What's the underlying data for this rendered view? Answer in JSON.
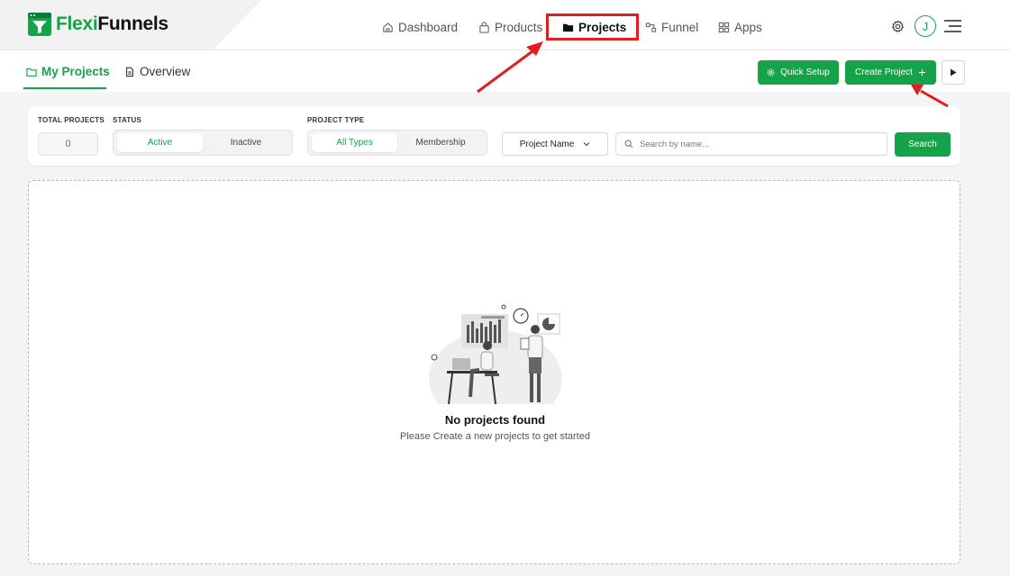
{
  "brand": {
    "name_part1": "Flexi",
    "name_part2": "Funnels",
    "logo_icon": "funnel-logo-icon",
    "accent": "#15a34a"
  },
  "nav": {
    "items": [
      {
        "label": "Dashboard",
        "icon": "home-icon"
      },
      {
        "label": "Products",
        "icon": "bag-icon"
      },
      {
        "label": "Projects",
        "icon": "folder-icon",
        "active": true
      },
      {
        "label": "Funnel",
        "icon": "funnel-icon"
      },
      {
        "label": "Apps",
        "icon": "grid-icon"
      }
    ],
    "avatar_initial": "J"
  },
  "subnav": {
    "tabs": [
      {
        "label": "My Projects",
        "icon": "folder-icon",
        "active": true
      },
      {
        "label": "Overview",
        "icon": "document-icon"
      }
    ],
    "quick_setup_label": "Quick Setup",
    "create_project_label": "Create Project"
  },
  "filters": {
    "total_projects_label": "TOTAL PROJECTS",
    "total_projects_value": "0",
    "status_label": "STATUS",
    "status_options": [
      "Active",
      "Inactive"
    ],
    "status_selected": "Active",
    "type_label": "PROJECT TYPE",
    "type_options": [
      "All Types",
      "Membership"
    ],
    "type_selected": "All Types",
    "sort_select_value": "Project Name",
    "search_placeholder": "Search by name...",
    "search_button_label": "Search"
  },
  "empty_state": {
    "title": "No projects found",
    "subtitle": "Please Create a new projects to get started"
  },
  "colors": {
    "annotation_red": "#e11d1d",
    "primary_green": "#15a34a"
  }
}
